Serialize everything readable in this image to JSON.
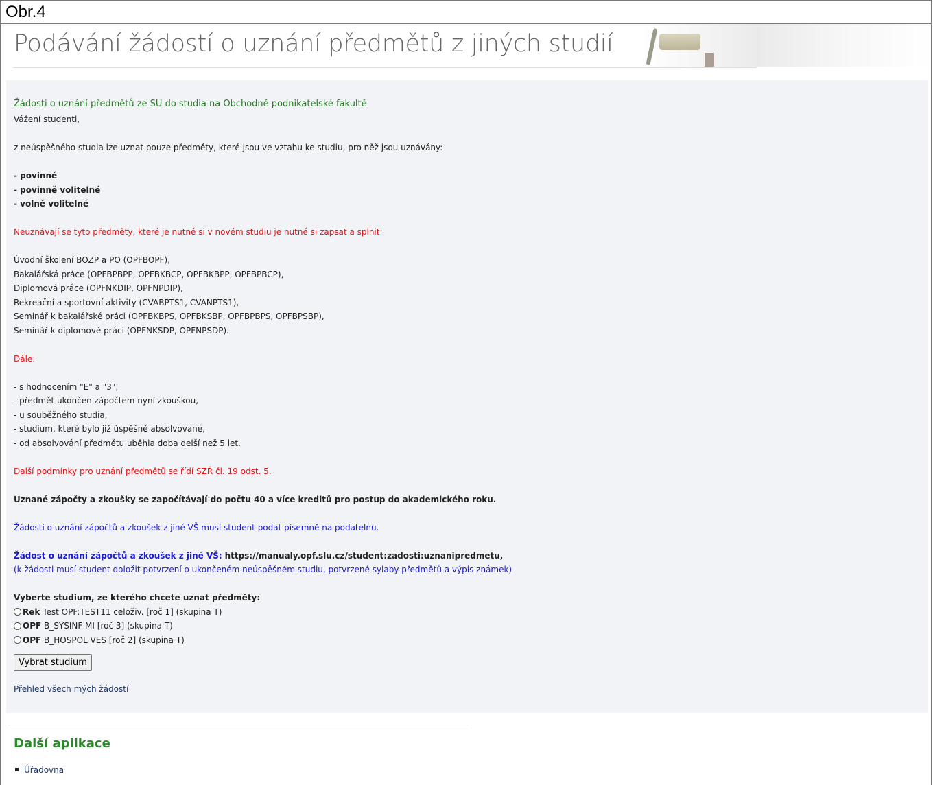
{
  "figure_label": "Obr.4",
  "page_title": "Podávání žádostí o uznání předmětů z jiných studií",
  "section_heading": "Žádosti o uznání předmětů ze SU do studia na Obchodně podnikatelské fakultě",
  "greeting": "Vážení studenti,",
  "intro": "z neúspěšného studia lze uznat pouze předměty, které jsou ve vztahu ke studiu, pro něž jsou uznávány:",
  "allowed_types": [
    "- povinné",
    "- povinně volitelné",
    "- volně volitelné"
  ],
  "not_recognized_heading": "Neuznávají se tyto předměty, které je nutné si v novém studiu je nutné si zapsat a splnit:",
  "not_recognized_items": [
    "Úvodní školení BOZP a PO (OPFBOPF),",
    "Bakalářská práce (OPFBPBPP, OPFBKBCP, OPFBKBPP, OPFBPBCP),",
    "Diplomová práce (OPFNKDIP, OPFNPDIP),",
    "Rekreační a sportovní aktivity (CVABPTS1, CVANPTS1),",
    "Seminář k bakalářské práci (OPFBKBPS, OPFBKSBP, OPFBPBPS, OPFBPSBP),",
    "Seminář k diplomové práci (OPFNKSDP, OPFNPSDP)."
  ],
  "further_heading": "Dále:",
  "further_items": [
    "- s hodnocením \"E\" a \"3\",",
    "- předmět ukončen zápočtem nyní zkouškou,",
    "- u souběžného studia,",
    "- studium, které bylo již úspěšně absolvované,",
    "- od absolvování předmětu uběhla doba delší než 5 let."
  ],
  "conditions_note": "Další podmínky pro uznání předmětů se řídí SZŘ čl. 19 odst. 5.",
  "credits_note": "Uznané zápočty a zkoušky se započítávají do počtu 40 a více kreditů pro postup do akademického roku.",
  "submission_note": "Žádosti o uznání zápočtů a zkoušek z jiné VŠ musí student podat písemně na podatelnu.",
  "request_link_label": "Žádost o uznání zápočtů a zkoušek z jiné VŠ:",
  "request_link_url": "https://manualy.opf.slu.cz/student:zadosti:uznanipredmetu,",
  "request_link_note": "(k žádosti musí student doložit potvrzení o ukončeném neúspěšném studiu, potvrzené sylaby předmětů a výpis známek)",
  "select_prompt": "Vyberte studium, ze kterého chcete uznat předměty:",
  "study_options": [
    {
      "faculty": "Rek",
      "text": "Test OPF:TEST11 celoživ. [roč 1] (skupina T)"
    },
    {
      "faculty": "OPF",
      "text": "B_SYSINF MI [roč 3] (skupina T)"
    },
    {
      "faculty": "OPF",
      "text": "B_HOSPOL VES [roč 2] (skupina T)"
    }
  ],
  "select_button": "Vybrat studium",
  "overview_link": "Přehled všech mých žádostí",
  "other_apps_heading": "Další aplikace",
  "other_apps": [
    "Úřadovna"
  ]
}
